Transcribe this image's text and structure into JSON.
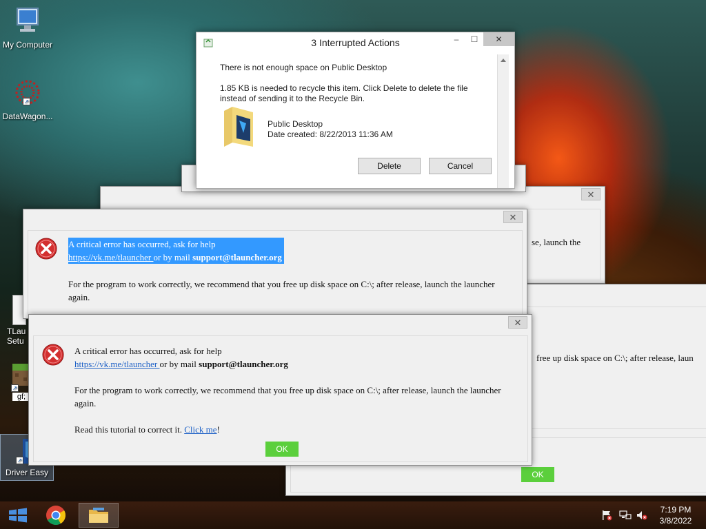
{
  "desktop": {
    "icons": [
      {
        "label": "My Computer",
        "icon": "computer-icon"
      },
      {
        "label": "DataWagon...",
        "icon": "datawagon-icon"
      },
      {
        "label": "TLau\nSetu",
        "icon": "document-icon"
      },
      {
        "label": "gf;",
        "icon": "minecraft-icon"
      },
      {
        "label": "Driver Easy",
        "icon": "driver-easy-icon"
      }
    ]
  },
  "interrupted_dialog": {
    "title": "3 Interrupted Actions",
    "heading": "There is not enough space on Public Desktop",
    "message": "1.85 KB is needed to recycle this item. Click Delete to delete the file instead of sending it to the Recycle Bin.",
    "item_name": "Public Desktop",
    "item_date": "Date created: 8/22/2013 11:36 AM",
    "delete_label": "Delete",
    "cancel_label": "Cancel",
    "minimize": "–",
    "maximize": "☐",
    "close": "✕"
  },
  "error_dialog_front": {
    "line1": "A critical error has occurred, ask for help",
    "link": "https://vk.me/tlauncher ",
    "mail_prefix": "or by mail ",
    "mail": "support@tlauncher.org",
    "para": "For the program to work correctly, we recommend that you free up disk space on C:\\; after release, launch the launcher again.",
    "tutorial_prefix": "Read this tutorial to correct it. ",
    "tutorial_link": "Click me",
    "tutorial_suffix": "!",
    "ok_label": "OK",
    "close": "✕"
  },
  "error_dialog_middle": {
    "line1": "A critical error has occurred, ask for help",
    "link": "https://vk.me/tlauncher ",
    "mail_prefix": "or by mail ",
    "mail": "support@tlauncher.org",
    "para": "For the program to work correctly, we recommend that you free up disk space on C:\\; after release, launch the launcher again.",
    "close": "✕"
  },
  "error_dialog_back_top": {
    "fragment": "se, launch the",
    "close": "✕"
  },
  "error_dialog_back_bottom": {
    "fragment": "free up disk space on C:\\; after release, laun",
    "ok_label": "OK"
  },
  "taskbar": {
    "time": "7:19 PM",
    "date": "3/8/2022",
    "items": [
      "start-icon",
      "chrome-icon",
      "file-explorer-icon"
    ],
    "tray": [
      "flag-icon",
      "network-icon",
      "volume-icon"
    ]
  },
  "colors": {
    "ok_green": "#5bcf3c",
    "link_blue": "#1b5fc6",
    "selection_blue": "#3399ff",
    "error_red": "#d32f2f"
  }
}
